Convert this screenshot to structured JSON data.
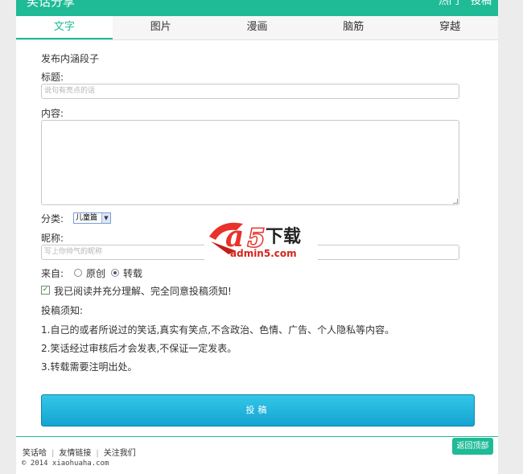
{
  "header": {
    "site_title": "笑话分享",
    "links": [
      "热门",
      "投稿"
    ]
  },
  "tabs": [
    {
      "label": "文字",
      "active": true
    },
    {
      "label": "图片",
      "active": false
    },
    {
      "label": "漫画",
      "active": false
    },
    {
      "label": "脑筋",
      "active": false
    },
    {
      "label": "穿越",
      "active": false
    }
  ],
  "form": {
    "heading": "发布内涵段子",
    "title_label": "标题:",
    "title_placeholder": "说句有亮点的话",
    "content_label": "内容:",
    "category_label": "分类:",
    "category_value": "儿童篇",
    "nickname_label": "昵称:",
    "nickname_placeholder": "写上你帅气的昵称",
    "source_label": "来自:",
    "source_options": [
      "原创",
      "转载"
    ],
    "source_selected": "转载",
    "agree_checked": true,
    "agree_text": "我已阅读并充分理解、完全同意投稿须知!",
    "notice_title": "投稿须知:",
    "notice_items": [
      "1.自己的或者所说过的笑话,真实有笑点,不含政治、色情、广告、个人隐私等内容。",
      "2.笑话经过审核后才会发表,不保证一定发表。",
      "3.转载需要注明出处。"
    ],
    "submit_label": "投稿"
  },
  "watermark": {
    "brand": "下载",
    "domain": "admin5.com"
  },
  "footer": {
    "links": [
      "笑话哈",
      "友情链接",
      "关注我们"
    ],
    "copyright": "© 2014 xiaohuaha.com",
    "back_to_top": "返回顶部"
  },
  "colors": {
    "accent": "#1fba96",
    "button": "#1ba9d6"
  }
}
